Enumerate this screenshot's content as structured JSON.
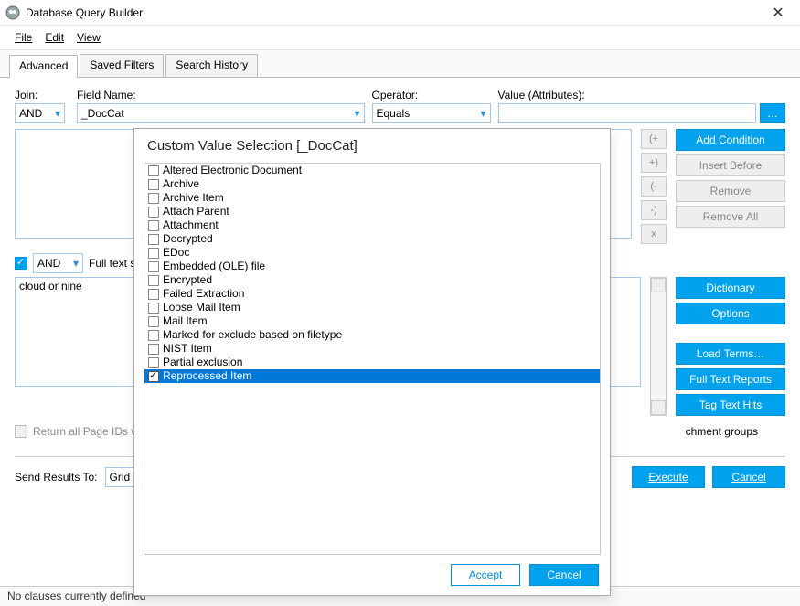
{
  "window": {
    "title": "Database Query Builder"
  },
  "menu": {
    "file": "File",
    "edit": "Edit",
    "view": "View"
  },
  "tabs": {
    "advanced": "Advanced",
    "saved": "Saved Filters",
    "history": "Search History"
  },
  "labels": {
    "join": "Join:",
    "field": "Field Name:",
    "operator": "Operator:",
    "value": "Value (Attributes):",
    "fulltext": "Full text s",
    "return_ids": "Return all Page IDs wi",
    "att_groups": "chment groups",
    "send_to": "Send Results To:",
    "grid": "Grid Vie"
  },
  "selects": {
    "join": "AND",
    "field": "_DocCat",
    "operator": "Equals",
    "and2": "AND"
  },
  "buttons": {
    "dots": "…",
    "add_condition": "Add Condition",
    "insert_before": "Insert Before",
    "remove": "Remove",
    "remove_all": "Remove All",
    "paren_open_plus": "(+",
    "paren_plus_close": "+)",
    "paren_open_minus": "(-",
    "paren_minus_close": "-)",
    "x": "x",
    "dictionary": "Dictionary",
    "options": "Options",
    "load_terms": "Load Terms…",
    "ft_reports": "Full Text Reports",
    "tag_hits": "Tag Text Hits",
    "execute": "Execute",
    "cancel": "Cancel",
    "accept": "Accept",
    "cancel2": "Cancel"
  },
  "fulltext_value": "cloud or nine",
  "status": "No clauses currently defined",
  "modal": {
    "title": "Custom Value Selection [_DocCat]",
    "items": [
      {
        "label": "Altered Electronic Document",
        "checked": false
      },
      {
        "label": "Archive",
        "checked": false
      },
      {
        "label": "Archive Item",
        "checked": false
      },
      {
        "label": "Attach Parent",
        "checked": false
      },
      {
        "label": "Attachment",
        "checked": false
      },
      {
        "label": "Decrypted",
        "checked": false
      },
      {
        "label": "EDoc",
        "checked": false
      },
      {
        "label": "Embedded (OLE) file",
        "checked": false
      },
      {
        "label": "Encrypted",
        "checked": false
      },
      {
        "label": "Failed Extraction",
        "checked": false
      },
      {
        "label": "Loose Mail Item",
        "checked": false
      },
      {
        "label": "Mail Item",
        "checked": false
      },
      {
        "label": "Marked for exclude based on filetype",
        "checked": false
      },
      {
        "label": "NIST Item",
        "checked": false
      },
      {
        "label": "Partial exclusion",
        "checked": false
      },
      {
        "label": "Reprocessed Item",
        "checked": true
      }
    ]
  }
}
